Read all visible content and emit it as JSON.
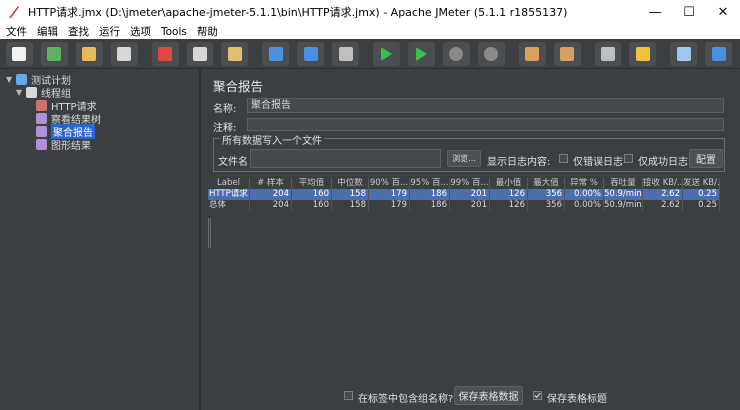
{
  "window": {
    "title": "HTTP请求.jmx (D:\\jmeter\\apache-jmeter-5.1.1\\bin\\HTTP请求.jmx) - Apache JMeter (5.1.1 r1855137)",
    "controls": [
      "—",
      "☐",
      "✕"
    ]
  },
  "menu": [
    "文件",
    "编辑",
    "查找",
    "运行",
    "选项",
    "Tools",
    "帮助"
  ],
  "toolbar": {
    "buttons": [
      {
        "name": "new-icon",
        "color": "#f2f2f2"
      },
      {
        "name": "templates-icon",
        "color": "#5fb25f"
      },
      {
        "name": "open-icon",
        "color": "#e8b85a"
      },
      {
        "name": "save-icon",
        "color": "#d8d8d8"
      },
      {
        "name": "cut-icon",
        "color": "#e04848"
      },
      {
        "name": "copy-icon",
        "color": "#d8d8d8"
      },
      {
        "name": "paste-icon",
        "color": "#e0c070"
      },
      {
        "name": "expand-icon",
        "color": "#4a8fe0"
      },
      {
        "name": "collapse-icon",
        "color": "#4a8fe0"
      },
      {
        "name": "toggle-icon",
        "color": "#c0c0c0"
      },
      {
        "name": "start-icon",
        "color": "#3cbf4a"
      },
      {
        "name": "start-no-pause-icon",
        "color": "#3cbf4a"
      },
      {
        "name": "stop-icon",
        "color": "#8a8a8a"
      },
      {
        "name": "shutdown-icon",
        "color": "#8a8a8a"
      },
      {
        "name": "clear-icon",
        "color": "#d8a060"
      },
      {
        "name": "clear-all-icon",
        "color": "#d8a060"
      },
      {
        "name": "search-icon",
        "color": "#c0c0c0"
      },
      {
        "name": "reset-search-icon",
        "color": "#f0c040"
      },
      {
        "name": "function-helper-icon",
        "color": "#a0c8f0"
      },
      {
        "name": "help-icon",
        "color": "#4a8fe0"
      }
    ]
  },
  "tree": [
    {
      "label": "测试计划",
      "level": 0,
      "caret": "▼",
      "icon": "test-plan-icon",
      "selected": false
    },
    {
      "label": "线程组",
      "level": 1,
      "caret": "▼",
      "icon": "thread-group-icon",
      "selected": false
    },
    {
      "label": "HTTP请求",
      "level": 2,
      "caret": "",
      "icon": "http-sampler-icon",
      "selected": false
    },
    {
      "label": "察看结果树",
      "level": 2,
      "caret": "",
      "icon": "listener-icon",
      "selected": false
    },
    {
      "label": "聚合报告",
      "level": 2,
      "caret": "",
      "icon": "listener-icon",
      "selected": true
    },
    {
      "label": "图形结果",
      "level": 2,
      "caret": "",
      "icon": "listener-icon",
      "selected": false
    }
  ],
  "panel": {
    "title": "聚合报告",
    "name_label": "名称:",
    "name_value": "聚合报告",
    "comment_label": "注释:",
    "comment_value": "",
    "file_legend": "所有数据写入一个文件",
    "filename_label": "文件名",
    "filename_value": "",
    "browse_button": "浏览...",
    "log_content_label": "显示日志内容:",
    "errors_only_label": "仅错误日志",
    "success_only_label": "仅成功日志",
    "config_button": "配置"
  },
  "table": {
    "columns": [
      "Label",
      "# 样本",
      "平均值",
      "中位数",
      "90% 百...",
      "95% 百...",
      "99% 百...",
      "最小值",
      "最大值",
      "异常 %",
      "吞吐量",
      "接收 KB/...",
      "发送 KB/..."
    ],
    "rows": [
      [
        "HTTP请求",
        "204",
        "160",
        "158",
        "179",
        "186",
        "201",
        "126",
        "356",
        "0.00%",
        "50.9/min",
        "2.62",
        "0.25"
      ],
      [
        "总体",
        "204",
        "160",
        "158",
        "179",
        "186",
        "201",
        "126",
        "356",
        "0.00%",
        "50.9/min",
        "2.62",
        "0.25"
      ]
    ],
    "selected_row": 0
  },
  "bottom": {
    "include_group_label": "在标签中包含组名称?",
    "include_group_checked": false,
    "save_table_button": "保存表格数据",
    "save_header_label": "保存表格标题",
    "save_header_checked": true
  }
}
